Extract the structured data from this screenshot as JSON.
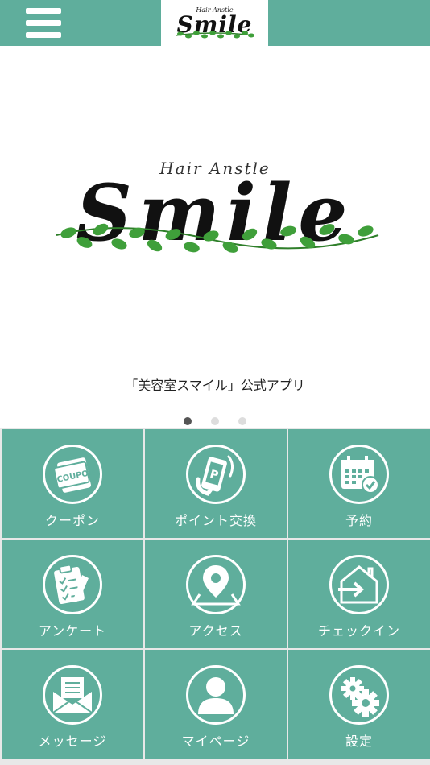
{
  "header": {
    "logo_small": "Hair Anstle",
    "logo_big": "Smile"
  },
  "banner": {
    "tagline": "Hair Anstle",
    "wordmark": "Smile"
  },
  "caption": "「美容室スマイル」公式アプリ",
  "carousel": {
    "count": 3,
    "active": 0
  },
  "tiles": [
    {
      "label": "クーポン",
      "icon": "coupon-icon",
      "badge": "COUPON"
    },
    {
      "label": "ポイント交換",
      "icon": "point-exchange-icon",
      "badge": "P"
    },
    {
      "label": "予約",
      "icon": "calendar-icon"
    },
    {
      "label": "アンケート",
      "icon": "clipboard-icon"
    },
    {
      "label": "アクセス",
      "icon": "map-pin-icon"
    },
    {
      "label": "チェックイン",
      "icon": "checkin-icon"
    },
    {
      "label": "メッセージ",
      "icon": "message-icon"
    },
    {
      "label": "マイページ",
      "icon": "user-icon"
    },
    {
      "label": "設定",
      "icon": "gear-icon"
    }
  ],
  "colors": {
    "accent": "#5fae9c",
    "leaf": "#3f9f3a"
  }
}
